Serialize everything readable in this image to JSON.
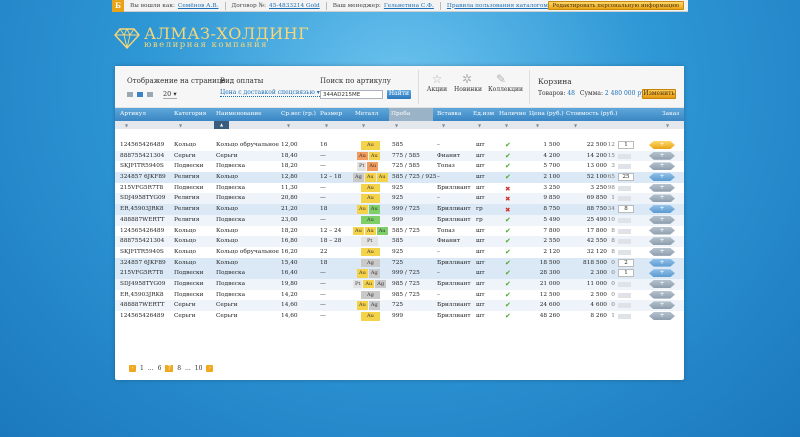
{
  "topbar": {
    "logo": "Б",
    "logged_as_label": "Вы вошли как:",
    "user_name": "Семёнов А.В.",
    "contract_label": "Договор №:",
    "contract_no": "45-4833214 Gold",
    "manager_label": "Ваш менеджер:",
    "manager_name": "Гельветина С.Ф.",
    "rules_link": "Правила пользования каталогом",
    "edit_btn": "Редактировать персональную информацию"
  },
  "brand": {
    "title": "АЛМАЗ-ХОЛДИНГ",
    "subtitle": "ювелирная компания"
  },
  "filters": {
    "display_label": "Отображение на странице",
    "per_page": "20",
    "payment_label": "Вид оплаты",
    "payment_value": "Цена с доставкой спецсвязью",
    "search_label": "Поиск по артикулу",
    "search_value": "344AD215ME",
    "search_btn": "Найти",
    "cat_actions": "Акции",
    "cat_new": "Новинки",
    "cat_collections": "Коллекции",
    "icons": {
      "actions": "star-icon",
      "new": "sparkle-icon",
      "collections": "pen-icon"
    }
  },
  "cart": {
    "title": "Корзина",
    "goods_label": "Товаров:",
    "goods_count": "48",
    "sum_label": "Сумма:",
    "sum_value": "2 480 000 руб.",
    "change_btn": "Изменить"
  },
  "columns": [
    "Артикул",
    "Категория",
    "Наименование",
    "Ср.вес (гр.)",
    "Размер",
    "Металл",
    "Проба",
    "Вставка",
    "Ед.изм",
    "Наличие",
    "Цена (руб.)",
    "Стоимость (руб.)",
    "Заказ"
  ],
  "rows": [
    {
      "art": "124565426489",
      "cat": "Кольцо",
      "name": "Кольцо обручальное",
      "weight": "12,00",
      "size": "16",
      "metal": [
        "Au"
      ],
      "probe": "585",
      "insert": "–",
      "unit": "шт",
      "stock": "yes",
      "price": "1 500",
      "cost": "22 500",
      "avail": "12",
      "qty": "1",
      "btn": "gold"
    },
    {
      "art": "888755421304",
      "cat": "Серьги",
      "name": "Серьги",
      "weight": "18,40",
      "size": "—",
      "metal": [
        "Au-red",
        "Au"
      ],
      "probe": "775 / 585",
      "insert": "Фианит",
      "unit": "шт",
      "stock": "yes",
      "price": "4 200",
      "cost": "14 200",
      "avail": "15",
      "qty": "0",
      "btn": "grey"
    },
    {
      "art": "SKJFITR5940S",
      "cat": "Подвески",
      "name": "Подвеска",
      "weight": "18,20",
      "size": "—",
      "metal": [
        "Pt",
        "Au-red"
      ],
      "probe": "725 / 585",
      "insert": "Топаз",
      "unit": "шт",
      "stock": "yes",
      "price": "5 700",
      "cost": "13 000",
      "avail": "3",
      "qty": "0",
      "btn": "grey"
    },
    {
      "art": "324857 6JKF89",
      "cat": "Религия",
      "name": "Кольцо",
      "weight": "12,80",
      "size": "12 – 18",
      "metal": [
        "Ag",
        "Au",
        "Au"
      ],
      "probe": "585 / 725 / 925",
      "insert": "–",
      "unit": "шт",
      "stock": "yes",
      "price": "2 100",
      "cost": "52 100",
      "avail": "65",
      "qty": "25",
      "btn": "blue"
    },
    {
      "art": "215VFG5R7T8",
      "cat": "Подвески",
      "name": "Подвеска",
      "weight": "11,30",
      "size": "—",
      "metal": [
        "Au"
      ],
      "probe": "925",
      "insert": "Бриллиант",
      "unit": "шт",
      "stock": "no",
      "price": "3 250",
      "cost": "3 250",
      "avail": "98",
      "qty": "0",
      "btn": "grey"
    },
    {
      "art": "SDJ4958TYG09",
      "cat": "Религия",
      "name": "Подвеска",
      "weight": "20,80",
      "size": "—",
      "metal": [
        "Au"
      ],
      "probe": "925",
      "insert": "–",
      "unit": "шт",
      "stock": "no",
      "price": "9 850",
      "cost": "69 850",
      "avail": "1",
      "qty": "0",
      "btn": "grey"
    },
    {
      "art": "ER,45903JRK8",
      "cat": "Религия",
      "name": "Кольцо",
      "weight": "21,20",
      "size": "18",
      "metal": [
        "Au",
        "Au-green"
      ],
      "probe": "999 / 725",
      "insert": "Бриллиант",
      "unit": "гр",
      "stock": "no",
      "price": "8 750",
      "cost": "88 750",
      "avail": "34",
      "qty": "8",
      "btn": "blue"
    },
    {
      "art": "488887WERTT",
      "cat": "Религия",
      "name": "Подвеска",
      "weight": "23,00",
      "size": "—",
      "metal": [
        "Au-green"
      ],
      "probe": "999",
      "insert": "Бриллиант",
      "unit": "гр",
      "stock": "yes",
      "price": "5 490",
      "cost": "25 490",
      "avail": "10",
      "qty": "0",
      "btn": "grey"
    },
    {
      "art": "124565426489",
      "cat": "Кольцо",
      "name": "Кольцо",
      "weight": "18,20",
      "size": "12 – 24",
      "metal": [
        "Au",
        "Au",
        "Au-green"
      ],
      "probe": "585 / 725",
      "insert": "Топаз",
      "unit": "шт",
      "stock": "yes",
      "price": "7 800",
      "cost": "17 800",
      "avail": "8",
      "qty": "0",
      "btn": "grey"
    },
    {
      "art": "888755421304",
      "cat": "Кольцо",
      "name": "Кольцо",
      "weight": "16,80",
      "size": "18 – 28",
      "metal": [
        "Pt"
      ],
      "probe": "585",
      "insert": "Фианит",
      "unit": "шт",
      "stock": "yes",
      "price": "2 550",
      "cost": "42 550",
      "avail": "8",
      "qty": "0",
      "btn": "grey"
    },
    {
      "art": "SKJFITR5940S",
      "cat": "Кольцо",
      "name": "Кольцо обручальное",
      "weight": "16,20",
      "size": "22",
      "metal": [
        "Au"
      ],
      "probe": "925",
      "insert": "–",
      "unit": "шт",
      "stock": "yes",
      "price": "2 120",
      "cost": "32 120",
      "avail": "8",
      "qty": "0",
      "btn": "grey"
    },
    {
      "art": "324857 6JKF89",
      "cat": "Кольцо",
      "name": "Кольцо",
      "weight": "15,40",
      "size": "18",
      "metal": [
        "Ag"
      ],
      "probe": "725",
      "insert": "Бриллиант",
      "unit": "шт",
      "stock": "yes",
      "price": "18 500",
      "cost": "818 500",
      "avail": "0",
      "qty": "2",
      "btn": "blue"
    },
    {
      "art": "215VFG5R7T8",
      "cat": "Подвески",
      "name": "Подвеска",
      "weight": "16,40",
      "size": "—",
      "metal": [
        "Au",
        "Ag"
      ],
      "probe": "999 / 725",
      "insert": "–",
      "unit": "шт",
      "stock": "yes",
      "price": "28 300",
      "cost": "2 300",
      "avail": "0",
      "qty": "1",
      "btn": "blue"
    },
    {
      "art": "SDJ4958TYG09",
      "cat": "Подвески",
      "name": "Подвеска",
      "weight": "19,80",
      "size": "—",
      "metal": [
        "Pt",
        "Au",
        "Ag"
      ],
      "probe": "985 / 725",
      "insert": "Бриллиант",
      "unit": "шт",
      "stock": "yes",
      "price": "21 000",
      "cost": "11 000",
      "avail": "0",
      "qty": "0",
      "btn": "grey"
    },
    {
      "art": "ER,45903JRK8",
      "cat": "Подвески",
      "name": "Подвеска",
      "weight": "14,20",
      "size": "—",
      "metal": [
        "Ag"
      ],
      "probe": "985 / 725",
      "insert": "–",
      "unit": "шт",
      "stock": "yes",
      "price": "12 500",
      "cost": "2 500",
      "avail": "0",
      "qty": "0",
      "btn": "grey"
    },
    {
      "art": "488887WERTT",
      "cat": "Серьги",
      "name": "Серьги",
      "weight": "14,60",
      "size": "—",
      "metal": [
        "Au",
        "Ag"
      ],
      "probe": "725",
      "insert": "Бриллиант",
      "unit": "шт",
      "stock": "yes",
      "price": "24 600",
      "cost": "4 600",
      "avail": "0",
      "qty": "0",
      "btn": "grey"
    },
    {
      "art": "124565426489",
      "cat": "Серьги",
      "name": "Серьги",
      "weight": "14,60",
      "size": "—",
      "metal": [
        "Au"
      ],
      "probe": "999",
      "insert": "Бриллиант",
      "unit": "шт",
      "stock": "yes",
      "price": "48 260",
      "cost": "8 260",
      "avail": "1",
      "qty": "0",
      "btn": "grey"
    }
  ],
  "pager": {
    "first": "1",
    "dots1": "...",
    "p6": "6",
    "current": "7",
    "p8": "8",
    "dots2": "...",
    "last": "10"
  },
  "colors": {
    "accent": "#2b78bd",
    "gold": "#e8a313",
    "ok": "#4aa62b",
    "no": "#d23232"
  }
}
